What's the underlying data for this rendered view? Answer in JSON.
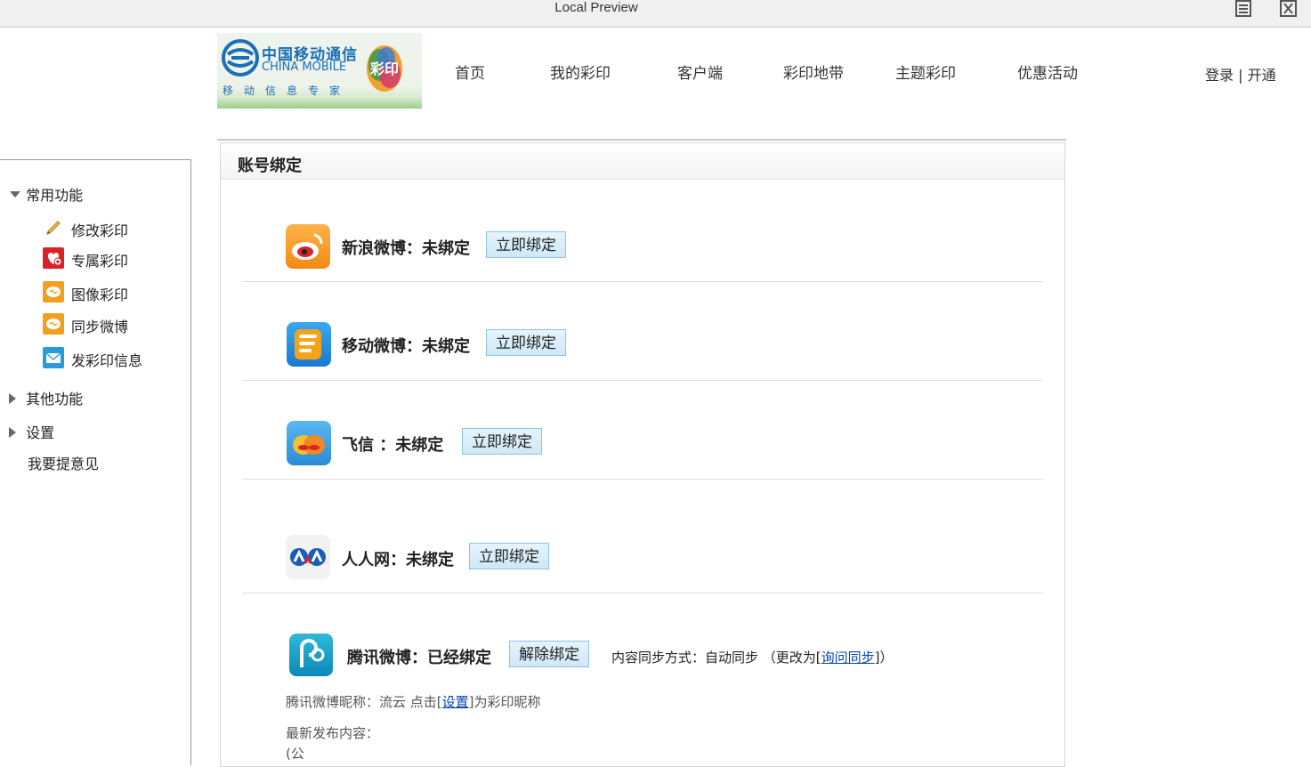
{
  "window": {
    "title": "Local Preview"
  },
  "logo": {
    "cn": "中国移动通信",
    "en": "CHINA MOBILE",
    "sub": "移动信息专家",
    "badge_text": "彩印"
  },
  "nav": [
    {
      "label": "首页"
    },
    {
      "label": "我的彩印"
    },
    {
      "label": "客户端"
    },
    {
      "label": "彩印地带"
    },
    {
      "label": "主题彩印"
    },
    {
      "label": "优惠活动"
    }
  ],
  "auth": {
    "login": "登录",
    "sep": "|",
    "open": "开通"
  },
  "sidebar": {
    "group_common": "常用功能",
    "items": [
      {
        "label": "修改彩印",
        "icon": "pencil-icon"
      },
      {
        "label": "专属彩印",
        "icon": "heart-plus-icon"
      },
      {
        "label": "图像彩印",
        "icon": "brain-bubble-icon"
      },
      {
        "label": "同步微博",
        "icon": "brain-bubble-icon"
      },
      {
        "label": "发彩印信息",
        "icon": "envelope-icon"
      }
    ],
    "group_other": "其他功能",
    "group_settings": "设置",
    "feedback": "我要提意见"
  },
  "panel": {
    "title": "账号绑定",
    "services": [
      {
        "name": "新浪微博：未绑定",
        "button": "立即绑定",
        "icon": "sina-weibo-icon"
      },
      {
        "name": "移动微博：未绑定",
        "button": "立即绑定",
        "icon": "mobile-weibo-icon"
      },
      {
        "name": "飞信 ：未绑定",
        "button": "立即绑定",
        "icon": "fetion-icon"
      },
      {
        "name": "人人网：未绑定",
        "button": "立即绑定",
        "icon": "renren-icon"
      },
      {
        "name": "腾讯微博：已经绑定",
        "button": "解除绑定",
        "icon": "tencent-weibo-icon"
      }
    ],
    "sync": {
      "prefix": "内容同步方式：自动同步 （更改为[",
      "link": "询问同步",
      "suffix": "]）"
    },
    "nick": {
      "prefix": "腾讯微博昵称：流云  点击[",
      "link": "设置",
      "suffix": "]为彩印昵称"
    },
    "latest": "最新发布内容：",
    "latest_body": "(公"
  },
  "colors": {
    "link": "#0645ad",
    "button_bg": "#d7ecf8",
    "button_border": "#8ec3e2",
    "brand_blue": "#1a6fb8"
  }
}
